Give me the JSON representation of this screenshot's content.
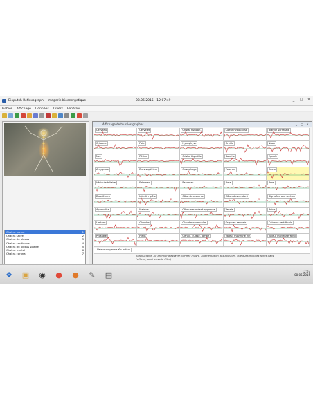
{
  "window": {
    "title": "Bioputsh Reflexographi - Imagerie bioenergetique",
    "datetime": "08.06.2015 - 12:07:49",
    "controls": [
      "_",
      "□",
      "×"
    ]
  },
  "menu": [
    "Fichier",
    "Affichage",
    "Données",
    "Divers",
    "Fenêtres"
  ],
  "toolbar": {
    "tool_colors": [
      "#d9b23b",
      "#7aa6d9",
      "#3d9b47",
      "#d4473a",
      "#e0a63b",
      "#6b7bd1",
      "#9a9a9a",
      "#c13a3a",
      "#d9b23b",
      "#4f86c7",
      "#8a8a8a",
      "#3d9b47",
      "#d94a3a",
      "#a0a0a0"
    ]
  },
  "graphs_window": {
    "title": "Affichage de tous les graphes",
    "cells": [
      "Cerveau",
      "Cervelet",
      "Cristal hypoph.",
      "Coeur hypophyse",
      "glande surrénale",
      "Crisaeur",
      "Foie",
      "Hypophyse",
      "Oreille",
      "Nasa",
      "Nez",
      "Rétine",
      "Cristal thyroïde",
      "Bouche",
      "Epaule",
      "Amygdale",
      "Bras supérieur",
      "Oesophage",
      "Poumon",
      "Coeur",
      "Vésicule biliaire",
      "Estomac",
      "Pancréas",
      "Rate",
      "Pore",
      "Duodénum",
      "Intestin grêle",
      "Côlon transverse",
      "Côlon descendant",
      "Sigmoïde ano rectum",
      "Appendice",
      "Matrice",
      "Côlon ascendant zygomes",
      "Vessie",
      "Reins",
      "Uretère",
      "Glandes",
      "Glandes surrénales",
      "Organes sexuels",
      "Colonne vertébrale",
      "Prostate",
      "Pieds",
      "Genou, cuisse, jambe",
      "Valeur moyenne Yin",
      "Valeur moyenne Yang"
    ],
    "last_row_label": "Valeur moyenne Yin active",
    "note": "Bilan(Graphe - le premier à essayer, vérifiez l'ordre, augmentation aux pouvoirs, quelques minutes après dans l'Affiche, avoir ensuite filtre)"
  },
  "patient_list": [
    {
      "label": "Chakra racine",
      "value": "1"
    },
    {
      "label": "Chakra sacré",
      "value": "2"
    },
    {
      "label": "Chakra du plexus",
      "value": "3"
    },
    {
      "label": "Chakra cardiaque",
      "value": "4"
    },
    {
      "label": "Chakra du plexus solaire",
      "value": "5"
    },
    {
      "label": "Chakra frontal",
      "value": "6"
    },
    {
      "label": "Chakra coronal",
      "value": "7"
    }
  ],
  "status": {
    "left": "",
    "right_label": "Main gauche",
    "right_value": "1298"
  },
  "taskbar": {
    "icons": [
      {
        "name": "windows-start-icon",
        "glyph": "❖",
        "color": "#2e6fc9"
      },
      {
        "name": "explorer-icon",
        "glyph": "▣",
        "color": "#d9a441"
      },
      {
        "name": "eye-app-icon",
        "glyph": "◉",
        "color": "#333333"
      },
      {
        "name": "chrome-icon",
        "glyph": "●",
        "color": "#e04a3a"
      },
      {
        "name": "firefox-icon",
        "glyph": "●",
        "color": "#e07a2a"
      },
      {
        "name": "pen-tool-icon",
        "glyph": "✎",
        "color": "#6a6a6a"
      },
      {
        "name": "notepad-icon",
        "glyph": "▤",
        "color": "#4a4a4a"
      }
    ],
    "clock": "12:07",
    "date": "08.06.2015"
  },
  "colors": {
    "signal": "#cc3a3a",
    "baseline": "#3aa66b",
    "highlight": "#fff9b3",
    "selection": "#3b78d8"
  }
}
